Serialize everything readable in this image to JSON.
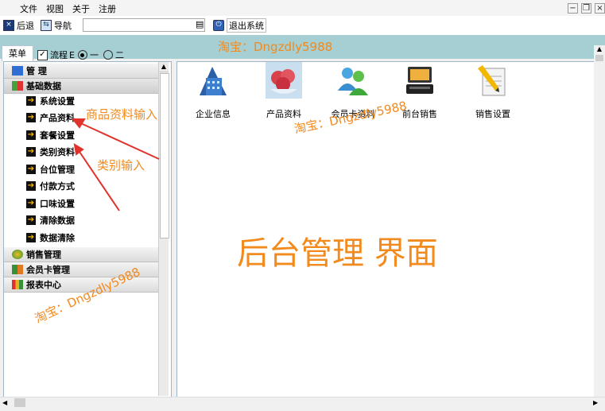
{
  "menubar": {
    "items": [
      "文件",
      "视图",
      "关于",
      "注册"
    ]
  },
  "toolbar": {
    "back_label": "后退",
    "nav_label": "导航",
    "exit_label": "退出系统"
  },
  "tabs": {
    "menu_label": "菜单",
    "flow_label": "流程",
    "flow_suffix": "E",
    "radio_one": "一",
    "radio_two": "二"
  },
  "sidebar": {
    "sections": [
      {
        "label": "管 理"
      },
      {
        "label": "基础数据"
      },
      {
        "label": "销售管理"
      },
      {
        "label": "会员卡管理"
      },
      {
        "label": "报表中心"
      }
    ],
    "items": [
      {
        "label": "系统设置"
      },
      {
        "label": "产品资料"
      },
      {
        "label": "套餐设置"
      },
      {
        "label": "类别资料"
      },
      {
        "label": "台位管理"
      },
      {
        "label": "付款方式"
      },
      {
        "label": "口味设置"
      },
      {
        "label": "清除数据"
      },
      {
        "label": "数据清除"
      }
    ]
  },
  "apps": [
    {
      "label": "企业信息",
      "icon": "building-icon"
    },
    {
      "label": "产品资料",
      "icon": "fruit-bowl-icon"
    },
    {
      "label": "会员卡资料",
      "icon": "members-icon"
    },
    {
      "label": "前台销售",
      "icon": "pos-terminal-icon"
    },
    {
      "label": "销售设置",
      "icon": "document-pencil-icon"
    }
  ],
  "annotations": {
    "watermark": "淘宝：Dngzdly5988",
    "product_note": "商品资料输入",
    "category_note": "类别输入",
    "title": "后台管理 界面"
  },
  "colors": {
    "band": "#a5cfd2",
    "watermark": "#f28a1e",
    "arrow_red": "#e0332b"
  }
}
